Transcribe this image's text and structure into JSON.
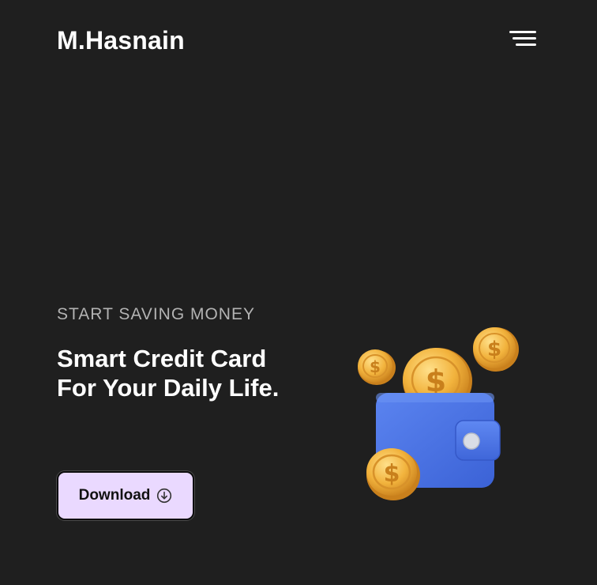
{
  "header": {
    "logo": "M.Hasnain",
    "menu_icon": "menu-icon"
  },
  "hero": {
    "eyebrow": "START SAVING MONEY",
    "headline": "Smart Credit Card For Your Daily Life.",
    "download_label": "Download",
    "download_icon": "download-circle-icon",
    "illustration": "wallet-with-coins-illustration"
  },
  "colors": {
    "background": "#1f1f1f",
    "button_bg": "#ead9ff",
    "wallet": "#4a72e0",
    "coin": "#f2b33d"
  }
}
